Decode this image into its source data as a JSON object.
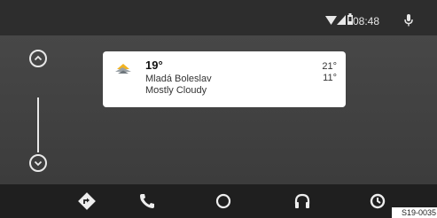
{
  "status_bar": {
    "time": "08:48",
    "icons": [
      "wifi-icon",
      "signal-icon",
      "battery-icon",
      "microphone-icon"
    ]
  },
  "scroll": {
    "up_icon": "chevron-up-icon",
    "down_icon": "chevron-down-icon"
  },
  "weather_card": {
    "icon": "partly-cloudy-icon",
    "temperature": "19°",
    "city": "Mladá Boleslav",
    "condition": "Mostly Cloudy",
    "high": "21°",
    "low": "11°"
  },
  "nav_bar": {
    "items": [
      {
        "icon": "navigation-icon"
      },
      {
        "icon": "phone-icon"
      },
      {
        "icon": "home-icon"
      },
      {
        "icon": "headphones-icon"
      },
      {
        "icon": "exit-icon"
      }
    ]
  },
  "caption": "S19-0035"
}
